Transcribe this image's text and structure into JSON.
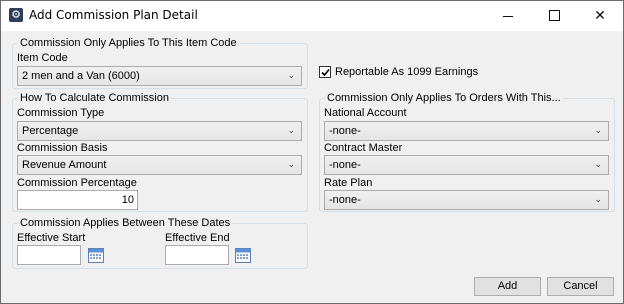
{
  "window": {
    "title": "Add Commission Plan Detail",
    "minimize_glyph": "",
    "maximize_glyph": "",
    "close_glyph": "✕"
  },
  "item_code_group": {
    "legend": "Commission Only Applies To This Item Code",
    "item_code_label": "Item Code",
    "item_code_value": "2 men and a Van (6000)"
  },
  "reportable": {
    "label": "Reportable As 1099 Earnings",
    "checked": true
  },
  "calc_group": {
    "legend": "How To Calculate Commission",
    "type_label": "Commission Type",
    "type_value": "Percentage",
    "basis_label": "Commission Basis",
    "basis_value": "Revenue Amount",
    "percentage_label": "Commission Percentage",
    "percentage_value": "10"
  },
  "orders_group": {
    "legend": "Commission Only Applies To Orders With This...",
    "national_account_label": "National Account",
    "national_account_value": "-none-",
    "contract_master_label": "Contract Master",
    "contract_master_value": "-none-",
    "rate_plan_label": "Rate Plan",
    "rate_plan_value": "-none-"
  },
  "dates_group": {
    "legend": "Commission Applies Between These Dates",
    "start_label": "Effective Start",
    "start_value": "",
    "end_label": "Effective End",
    "end_value": ""
  },
  "buttons": {
    "add": "Add",
    "cancel": "Cancel"
  },
  "icons": {
    "app": "settings-gear-icon",
    "dropdown": "chevron-down-icon",
    "calendar": "calendar-icon"
  }
}
